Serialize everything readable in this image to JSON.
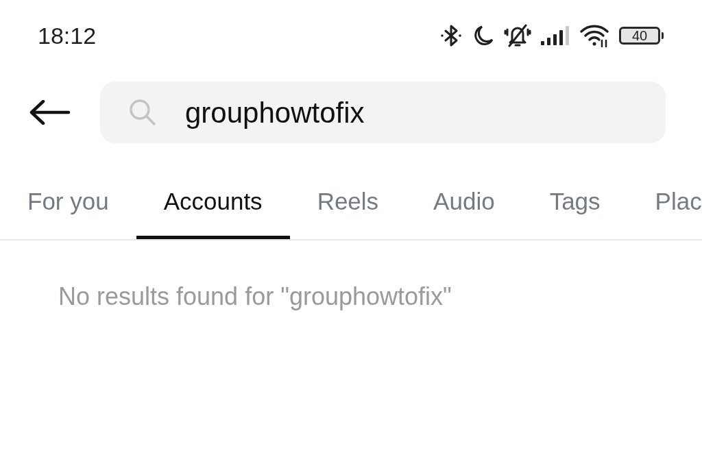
{
  "status_bar": {
    "time": "18:12",
    "battery": "40"
  },
  "search": {
    "value": "grouphowtofix"
  },
  "tabs": [
    {
      "label": "For you",
      "selected": false
    },
    {
      "label": "Accounts",
      "selected": true
    },
    {
      "label": "Reels",
      "selected": false
    },
    {
      "label": "Audio",
      "selected": false
    },
    {
      "label": "Tags",
      "selected": false
    },
    {
      "label": "Plac",
      "selected": false
    }
  ],
  "message": "No results found for \"grouphowtofix\""
}
